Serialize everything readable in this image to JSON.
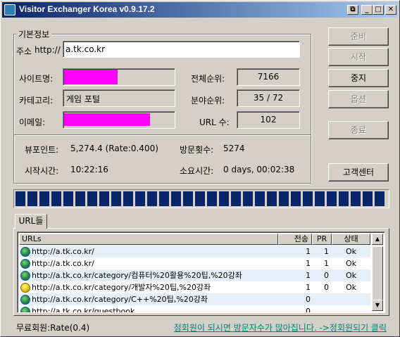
{
  "window": {
    "title": "Visitor Exchanger Korea v0.9.17.2",
    "controls": {
      "restore": "⧉",
      "minimize": "_",
      "maximize": "□",
      "close": "✕"
    }
  },
  "info": {
    "legend": "기본정보",
    "address_label": "주소",
    "address_prefix": "http://",
    "address_value": "a.tk.co.kr",
    "site_name_label": "사이트명:",
    "category_label": "카테고리:",
    "category_value": "게임 포털",
    "email_label": "이메일:",
    "total_rank_label": "전체순위:",
    "total_rank_value": "7166",
    "field_rank_label": "분야순위:",
    "field_rank_value": "35 / 72",
    "url_count_label": "URL 수:",
    "url_count_value": "102",
    "viewpoint_label": "뷰포인트:",
    "viewpoint_value": "5,274.4 (Rate:0.400)",
    "visits_label": "방문횟수:",
    "visits_value": "5274",
    "start_time_label": "시작시간:",
    "start_time_value": "10:22:16",
    "elapsed_label": "소요시간:",
    "elapsed_value": "0 days, 00:02:38"
  },
  "buttons": {
    "prepare": "준비",
    "start": "시작",
    "stop": "중지",
    "options": "옵션",
    "exit": "종료",
    "support": "고객센터"
  },
  "colors": {
    "masked": "#ff00ff",
    "progress": "#0a246a",
    "link": "#008080"
  },
  "progress": {
    "fraction": 1.0
  },
  "tabs": [
    {
      "label": "URL들"
    }
  ],
  "list": {
    "columns": {
      "url": "URLs",
      "sent": "전송",
      "pr": "PR",
      "status": "상태"
    },
    "rows": [
      {
        "icon": "globe-icon",
        "url": "http://a.tk.co.kr/",
        "sent": "1",
        "pr": "1",
        "status": "Ok"
      },
      {
        "icon": "globe-icon",
        "url": "http://a.tk.co.kr/",
        "sent": "1",
        "pr": "1",
        "status": "Ok"
      },
      {
        "icon": "globe-icon",
        "url": "http://a.tk.co.kr/category/컴퓨터%20활용%20팁,%20강좌",
        "sent": "1",
        "pr": "0",
        "status": "Ok"
      },
      {
        "icon": "warning-globe-icon",
        "url": "http://a.tk.co.kr/category/개발자%20팁,%20강좌",
        "sent": "1",
        "pr": "0",
        "status": "Ok"
      },
      {
        "icon": "globe-icon",
        "url": "http://a.tk.co.kr/category/C++%20팁,%20강좌",
        "sent": "0",
        "pr": "",
        "status": ""
      },
      {
        "icon": "globe-icon",
        "url": "http://a.tk.co.kr/guestbook",
        "sent": "0",
        "pr": "",
        "status": ""
      }
    ]
  },
  "status": {
    "member": "무료회원:Rate(0.4)",
    "promo_link": "정회원이 되시면 방문자수가 많아집니다. ->정회원되기 클릭"
  }
}
